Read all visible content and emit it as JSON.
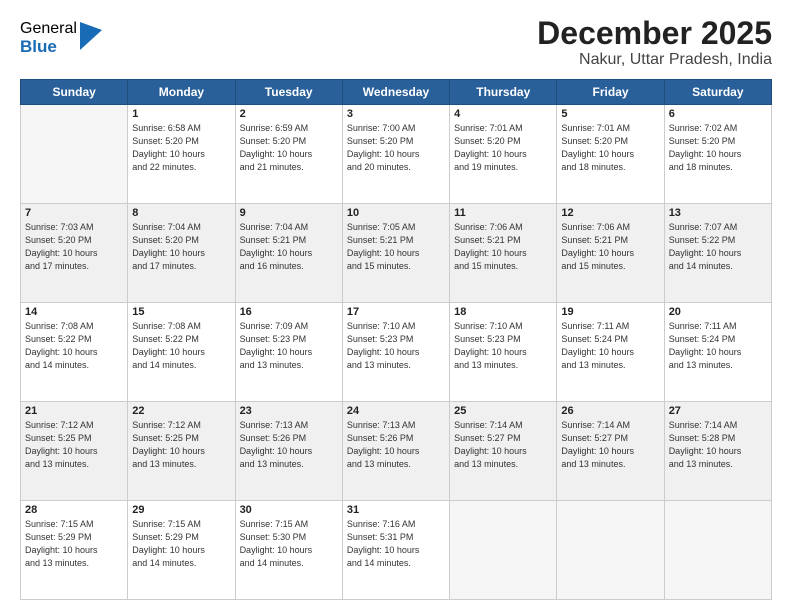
{
  "logo": {
    "general": "General",
    "blue": "Blue"
  },
  "header": {
    "month": "December 2025",
    "location": "Nakur, Uttar Pradesh, India"
  },
  "days_of_week": [
    "Sunday",
    "Monday",
    "Tuesday",
    "Wednesday",
    "Thursday",
    "Friday",
    "Saturday"
  ],
  "weeks": [
    [
      {
        "num": "",
        "info": ""
      },
      {
        "num": "1",
        "info": "Sunrise: 6:58 AM\nSunset: 5:20 PM\nDaylight: 10 hours\nand 22 minutes."
      },
      {
        "num": "2",
        "info": "Sunrise: 6:59 AM\nSunset: 5:20 PM\nDaylight: 10 hours\nand 21 minutes."
      },
      {
        "num": "3",
        "info": "Sunrise: 7:00 AM\nSunset: 5:20 PM\nDaylight: 10 hours\nand 20 minutes."
      },
      {
        "num": "4",
        "info": "Sunrise: 7:01 AM\nSunset: 5:20 PM\nDaylight: 10 hours\nand 19 minutes."
      },
      {
        "num": "5",
        "info": "Sunrise: 7:01 AM\nSunset: 5:20 PM\nDaylight: 10 hours\nand 18 minutes."
      },
      {
        "num": "6",
        "info": "Sunrise: 7:02 AM\nSunset: 5:20 PM\nDaylight: 10 hours\nand 18 minutes."
      }
    ],
    [
      {
        "num": "7",
        "info": "Sunrise: 7:03 AM\nSunset: 5:20 PM\nDaylight: 10 hours\nand 17 minutes."
      },
      {
        "num": "8",
        "info": "Sunrise: 7:04 AM\nSunset: 5:20 PM\nDaylight: 10 hours\nand 17 minutes."
      },
      {
        "num": "9",
        "info": "Sunrise: 7:04 AM\nSunset: 5:21 PM\nDaylight: 10 hours\nand 16 minutes."
      },
      {
        "num": "10",
        "info": "Sunrise: 7:05 AM\nSunset: 5:21 PM\nDaylight: 10 hours\nand 15 minutes."
      },
      {
        "num": "11",
        "info": "Sunrise: 7:06 AM\nSunset: 5:21 PM\nDaylight: 10 hours\nand 15 minutes."
      },
      {
        "num": "12",
        "info": "Sunrise: 7:06 AM\nSunset: 5:21 PM\nDaylight: 10 hours\nand 15 minutes."
      },
      {
        "num": "13",
        "info": "Sunrise: 7:07 AM\nSunset: 5:22 PM\nDaylight: 10 hours\nand 14 minutes."
      }
    ],
    [
      {
        "num": "14",
        "info": "Sunrise: 7:08 AM\nSunset: 5:22 PM\nDaylight: 10 hours\nand 14 minutes."
      },
      {
        "num": "15",
        "info": "Sunrise: 7:08 AM\nSunset: 5:22 PM\nDaylight: 10 hours\nand 14 minutes."
      },
      {
        "num": "16",
        "info": "Sunrise: 7:09 AM\nSunset: 5:23 PM\nDaylight: 10 hours\nand 13 minutes."
      },
      {
        "num": "17",
        "info": "Sunrise: 7:10 AM\nSunset: 5:23 PM\nDaylight: 10 hours\nand 13 minutes."
      },
      {
        "num": "18",
        "info": "Sunrise: 7:10 AM\nSunset: 5:23 PM\nDaylight: 10 hours\nand 13 minutes."
      },
      {
        "num": "19",
        "info": "Sunrise: 7:11 AM\nSunset: 5:24 PM\nDaylight: 10 hours\nand 13 minutes."
      },
      {
        "num": "20",
        "info": "Sunrise: 7:11 AM\nSunset: 5:24 PM\nDaylight: 10 hours\nand 13 minutes."
      }
    ],
    [
      {
        "num": "21",
        "info": "Sunrise: 7:12 AM\nSunset: 5:25 PM\nDaylight: 10 hours\nand 13 minutes."
      },
      {
        "num": "22",
        "info": "Sunrise: 7:12 AM\nSunset: 5:25 PM\nDaylight: 10 hours\nand 13 minutes."
      },
      {
        "num": "23",
        "info": "Sunrise: 7:13 AM\nSunset: 5:26 PM\nDaylight: 10 hours\nand 13 minutes."
      },
      {
        "num": "24",
        "info": "Sunrise: 7:13 AM\nSunset: 5:26 PM\nDaylight: 10 hours\nand 13 minutes."
      },
      {
        "num": "25",
        "info": "Sunrise: 7:14 AM\nSunset: 5:27 PM\nDaylight: 10 hours\nand 13 minutes."
      },
      {
        "num": "26",
        "info": "Sunrise: 7:14 AM\nSunset: 5:27 PM\nDaylight: 10 hours\nand 13 minutes."
      },
      {
        "num": "27",
        "info": "Sunrise: 7:14 AM\nSunset: 5:28 PM\nDaylight: 10 hours\nand 13 minutes."
      }
    ],
    [
      {
        "num": "28",
        "info": "Sunrise: 7:15 AM\nSunset: 5:29 PM\nDaylight: 10 hours\nand 13 minutes."
      },
      {
        "num": "29",
        "info": "Sunrise: 7:15 AM\nSunset: 5:29 PM\nDaylight: 10 hours\nand 14 minutes."
      },
      {
        "num": "30",
        "info": "Sunrise: 7:15 AM\nSunset: 5:30 PM\nDaylight: 10 hours\nand 14 minutes."
      },
      {
        "num": "31",
        "info": "Sunrise: 7:16 AM\nSunset: 5:31 PM\nDaylight: 10 hours\nand 14 minutes."
      },
      {
        "num": "",
        "info": ""
      },
      {
        "num": "",
        "info": ""
      },
      {
        "num": "",
        "info": ""
      }
    ]
  ]
}
